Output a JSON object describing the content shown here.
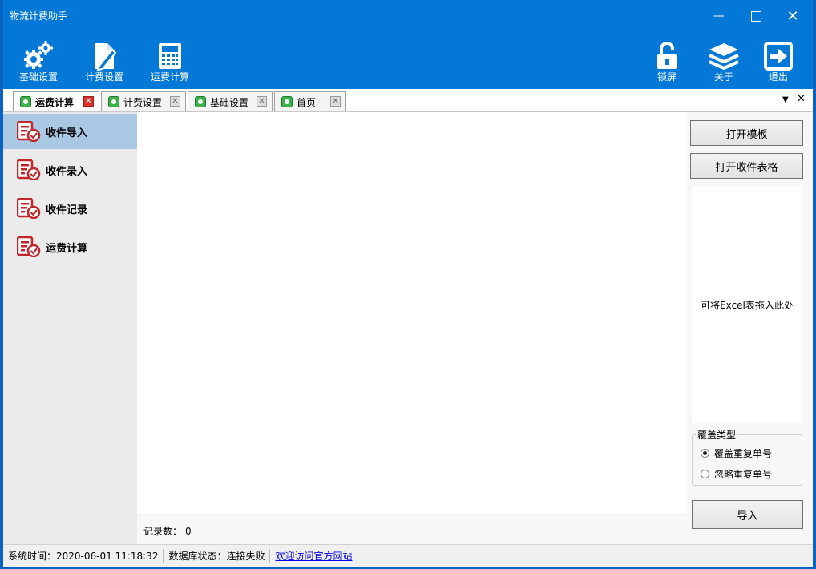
{
  "window": {
    "title": "物流计费助手",
    "minimize_glyph": "—",
    "maximize_glyph": "☐",
    "close_glyph": "✕"
  },
  "toolbar": {
    "left": [
      {
        "label": "基础设置",
        "icon": "gears-icon"
      },
      {
        "label": "计费设置",
        "icon": "document-pen-icon"
      },
      {
        "label": "运费计算",
        "icon": "calculator-icon"
      }
    ],
    "right": [
      {
        "label": "锁屏",
        "icon": "unlock-icon"
      },
      {
        "label": "关于",
        "icon": "layers-icon"
      },
      {
        "label": "退出",
        "icon": "exit-icon"
      }
    ]
  },
  "tabs": [
    {
      "label": "运费计算",
      "active": true
    },
    {
      "label": "计费设置",
      "active": false
    },
    {
      "label": "基础设置",
      "active": false
    },
    {
      "label": "首页",
      "active": false
    }
  ],
  "tab_controls": {
    "dropdown": "▼",
    "close": "✕"
  },
  "sidebar": {
    "items": [
      {
        "label": "收件导入",
        "active": true
      },
      {
        "label": "收件录入",
        "active": false
      },
      {
        "label": "收件记录",
        "active": false
      },
      {
        "label": "运费计算",
        "active": false
      }
    ]
  },
  "main": {
    "record_count_label": "记录数：",
    "record_count": "0"
  },
  "right_panel": {
    "open_template_label": "打开模板",
    "open_receipt_table_label": "打开收件表格",
    "drop_hint": "可将Excel表拖入此处",
    "overwrite_group_title": "覆盖类型",
    "options": [
      {
        "label": "覆盖重复单号",
        "checked": true
      },
      {
        "label": "忽略重复单号",
        "checked": false
      }
    ],
    "import_label": "导入"
  },
  "status": {
    "time_label": "系统时间：2020-06-01 11:18:32",
    "db_label": "数据库状态：连接失败",
    "link_label": "欢迎访问官方网站"
  },
  "colors": {
    "titlebar": "#0378d7",
    "active_nav": "#a8c8e4",
    "nav_icon": "#d8322a"
  }
}
